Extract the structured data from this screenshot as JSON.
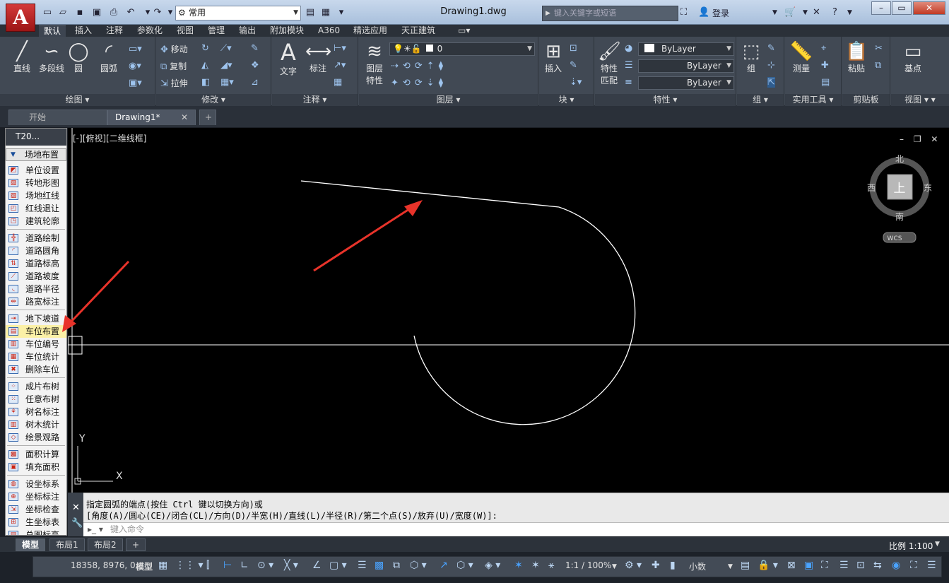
{
  "app_button": {
    "label": "A"
  },
  "quick_access": {
    "icons": [
      "new-icon",
      "open-icon",
      "save-icon",
      "save-as-icon",
      "print-icon",
      "undo-icon",
      "redo-icon"
    ],
    "workspace": "常用"
  },
  "title": "Drawing1.dwg",
  "search": {
    "placeholder": "键入关键字或短语"
  },
  "login": {
    "label": "登录"
  },
  "ribbon_tabs": [
    "默认",
    "插入",
    "注释",
    "参数化",
    "视图",
    "管理",
    "输出",
    "附加模块",
    "A360",
    "精选应用",
    "天正建筑"
  ],
  "ribbon": {
    "draw": {
      "title": "绘图",
      "line": "直线",
      "polyline": "多段线",
      "circle": "圆",
      "arc": "圆弧"
    },
    "modify": {
      "title": "修改",
      "move": "移动",
      "copy": "复制",
      "stretch": "拉伸"
    },
    "annotate": {
      "title": "注释",
      "text": "文字",
      "dim": "标注"
    },
    "layers": {
      "title": "图层",
      "props_line1": "图层",
      "props_line2": "特性",
      "current": "0"
    },
    "block": {
      "title": "块",
      "insert": "插入"
    },
    "properties": {
      "title": "特性",
      "match1": "特性",
      "match2": "匹配",
      "color": "ByLayer",
      "linetype": "ByLayer",
      "lineweight": "ByLayer"
    },
    "groups": {
      "title": "组",
      "group": "组"
    },
    "utilities": {
      "title": "实用工具",
      "measure": "测量"
    },
    "clipboard": {
      "title": "剪贴板",
      "paste": "粘贴"
    },
    "view": {
      "title": "视图",
      "base": "基点"
    }
  },
  "file_tabs": {
    "start": "开始",
    "drawing": "Drawing1*",
    "add": "+"
  },
  "sidebar": {
    "header": "T20...",
    "section": "场地布置",
    "groups": [
      [
        "单位设置",
        "转地形图",
        "场地红线",
        "红线退让",
        "建筑轮廓"
      ],
      [
        "道路绘制",
        "道路圆角",
        "道路标高",
        "道路坡度",
        "道路半径",
        "路宽标注"
      ],
      [
        "地下坡道",
        "车位布置",
        "车位编号",
        "车位统计",
        "删除车位"
      ],
      [
        "成片布树",
        "任意布树",
        "树名标注",
        "树木统计",
        "绘景观路"
      ],
      [
        "面积计算",
        "填充面积"
      ],
      [
        "设坐标系",
        "坐标标注",
        "坐标检查",
        "生坐标表",
        "总图标高"
      ]
    ],
    "highlighted": "车位布置"
  },
  "viewport": {
    "label": "[-][俯视][二维线框]",
    "controls": "– ❐ ✕"
  },
  "viewcube": {
    "north": "北",
    "south": "南",
    "east": "东",
    "west": "西",
    "face": "上",
    "wcs": "WCS"
  },
  "ucs": {
    "x": "X",
    "y": "Y"
  },
  "command": {
    "line1": "指定圆弧的端点(按住 Ctrl 键以切换方向)或",
    "line2": "[角度(A)/圆心(CE)/闭合(CL)/方向(D)/半宽(H)/直线(L)/半径(R)/第二个点(S)/放弃(U)/宽度(W)]:",
    "placeholder": "键入命令"
  },
  "layout_tabs": [
    "模型",
    "布局1",
    "布局2"
  ],
  "layout_add": "+",
  "statusbar": {
    "coords": "18358, 8976, 0",
    "model": "模型",
    "annoscale": "1:1 / 100%",
    "units": "小数",
    "scale": "比例 1:100"
  },
  "colors": {
    "arrow": "#e8332a",
    "accent": "#3a7dd6",
    "geometry": "#ffffff"
  }
}
